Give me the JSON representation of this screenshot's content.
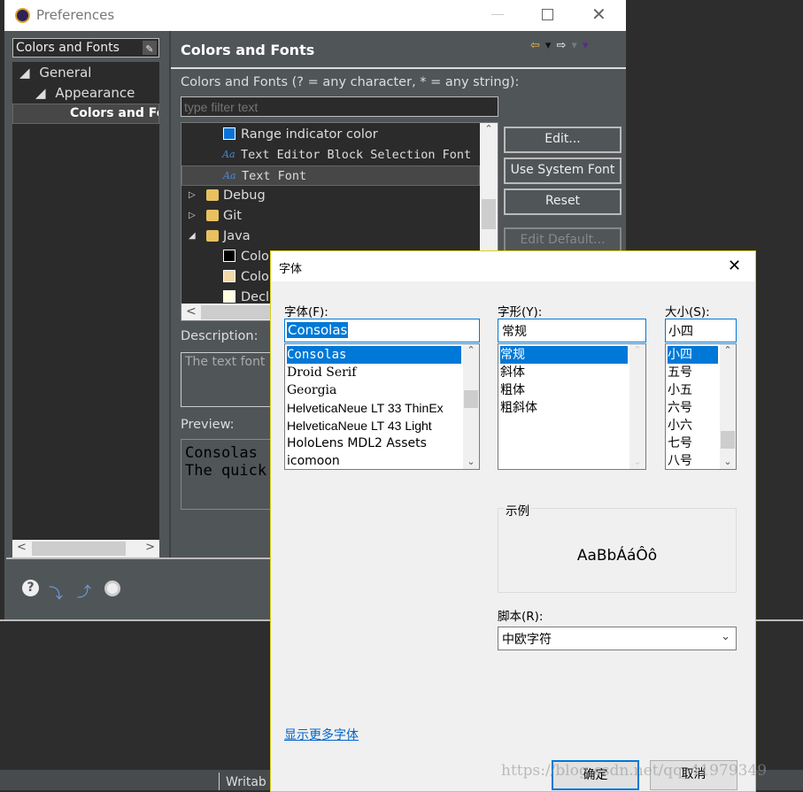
{
  "prefs": {
    "title": "Preferences",
    "filter_value": "Colors and Fonts",
    "tree": [
      "General",
      "Appearance",
      "Colors and Fo"
    ],
    "header": "Colors and Fonts",
    "filter_label": "Colors and Fonts (? = any character, * = any string):",
    "filter_placeholder": "type filter text",
    "items": [
      {
        "label": "Range indicator color",
        "type": "color",
        "color": "#0a73d8"
      },
      {
        "label": "Text Editor Block Selection Font",
        "type": "font"
      },
      {
        "label": "Text Font",
        "type": "font",
        "selected": true
      },
      {
        "label": "Debug",
        "type": "folder"
      },
      {
        "label": "Git",
        "type": "folder"
      },
      {
        "label": "Java",
        "type": "folder",
        "expanded": true
      },
      {
        "label": "Colo",
        "type": "color",
        "color": "#000000"
      },
      {
        "label": "Colo",
        "type": "color",
        "color": "#f3d9a8"
      },
      {
        "label": "Decl",
        "type": "color",
        "color": "#fffce0"
      }
    ],
    "buttons": {
      "edit": "Edit...",
      "system": "Use System Font",
      "reset": "Reset",
      "edit_default": "Edit Default..."
    },
    "description_label": "Description:",
    "description_text": "The text font",
    "preview_label": "Preview:",
    "preview_lines": [
      "Consolas",
      "The quick"
    ],
    "status_text": "Writab"
  },
  "font_dialog": {
    "title": "字体",
    "font_label": "字体(F):",
    "font_value": "Consolas",
    "fonts": [
      "Consolas",
      "Droid Serif",
      "Georgia",
      "HelveticaNeue LT 33 ThinEx",
      "HelveticaNeue LT 43 Light",
      "HoloLens MDL2 Assets",
      "icomoon"
    ],
    "style_label": "字形(Y):",
    "style_value": "常规",
    "styles": [
      "常规",
      "斜体",
      "粗体",
      "粗斜体"
    ],
    "size_label": "大小(S):",
    "size_value": "小四",
    "sizes": [
      "小四",
      "五号",
      "小五",
      "六号",
      "小六",
      "七号",
      "八号"
    ],
    "sample_label": "示例",
    "sample_text": "AaBbÁáÔô",
    "script_label": "脚本(R):",
    "script_value": "中欧字符",
    "more_fonts_link": "显示更多字体",
    "ok": "确定",
    "cancel": "取消",
    "watermark": "https://blog.csdn.net/qq_41979349"
  }
}
